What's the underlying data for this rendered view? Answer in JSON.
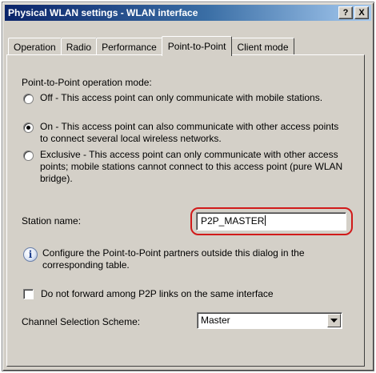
{
  "window": {
    "title": "Physical WLAN settings - WLAN interface",
    "help_button": "?",
    "close_button": "X"
  },
  "tabs": [
    {
      "label": "Operation",
      "active": false
    },
    {
      "label": "Radio",
      "active": false
    },
    {
      "label": "Performance",
      "active": false
    },
    {
      "label": "Point-to-Point",
      "active": true
    },
    {
      "label": "Client mode",
      "active": false
    }
  ],
  "p2p": {
    "mode_label": "Point-to-Point operation mode:",
    "options": [
      {
        "label": "Off - This access point can only communicate with mobile stations.",
        "selected": false
      },
      {
        "label": "On - This access point can also communicate with other access points to connect several local wireless networks.",
        "selected": true
      },
      {
        "label": "Exclusive - This access point can only communicate with other access points; mobile stations cannot connect to this access point (pure WLAN bridge).",
        "selected": false
      }
    ],
    "station_name_label": "Station name:",
    "station_name_value": "P2P_MASTER",
    "info_text": "Configure the Point-to-Point partners outside this dialog in the corresponding table.",
    "no_forward_label": "Do not forward among P2P links on the same interface",
    "no_forward_checked": false,
    "channel_scheme_label": "Channel Selection Scheme:",
    "channel_scheme_value": "Master"
  },
  "colors": {
    "highlight": "#d11a1a",
    "titlebar_start": "#0a246a",
    "titlebar_end": "#a6caf0"
  },
  "icons": {
    "info": "info-icon",
    "dropdown": "chevron-down-icon"
  }
}
